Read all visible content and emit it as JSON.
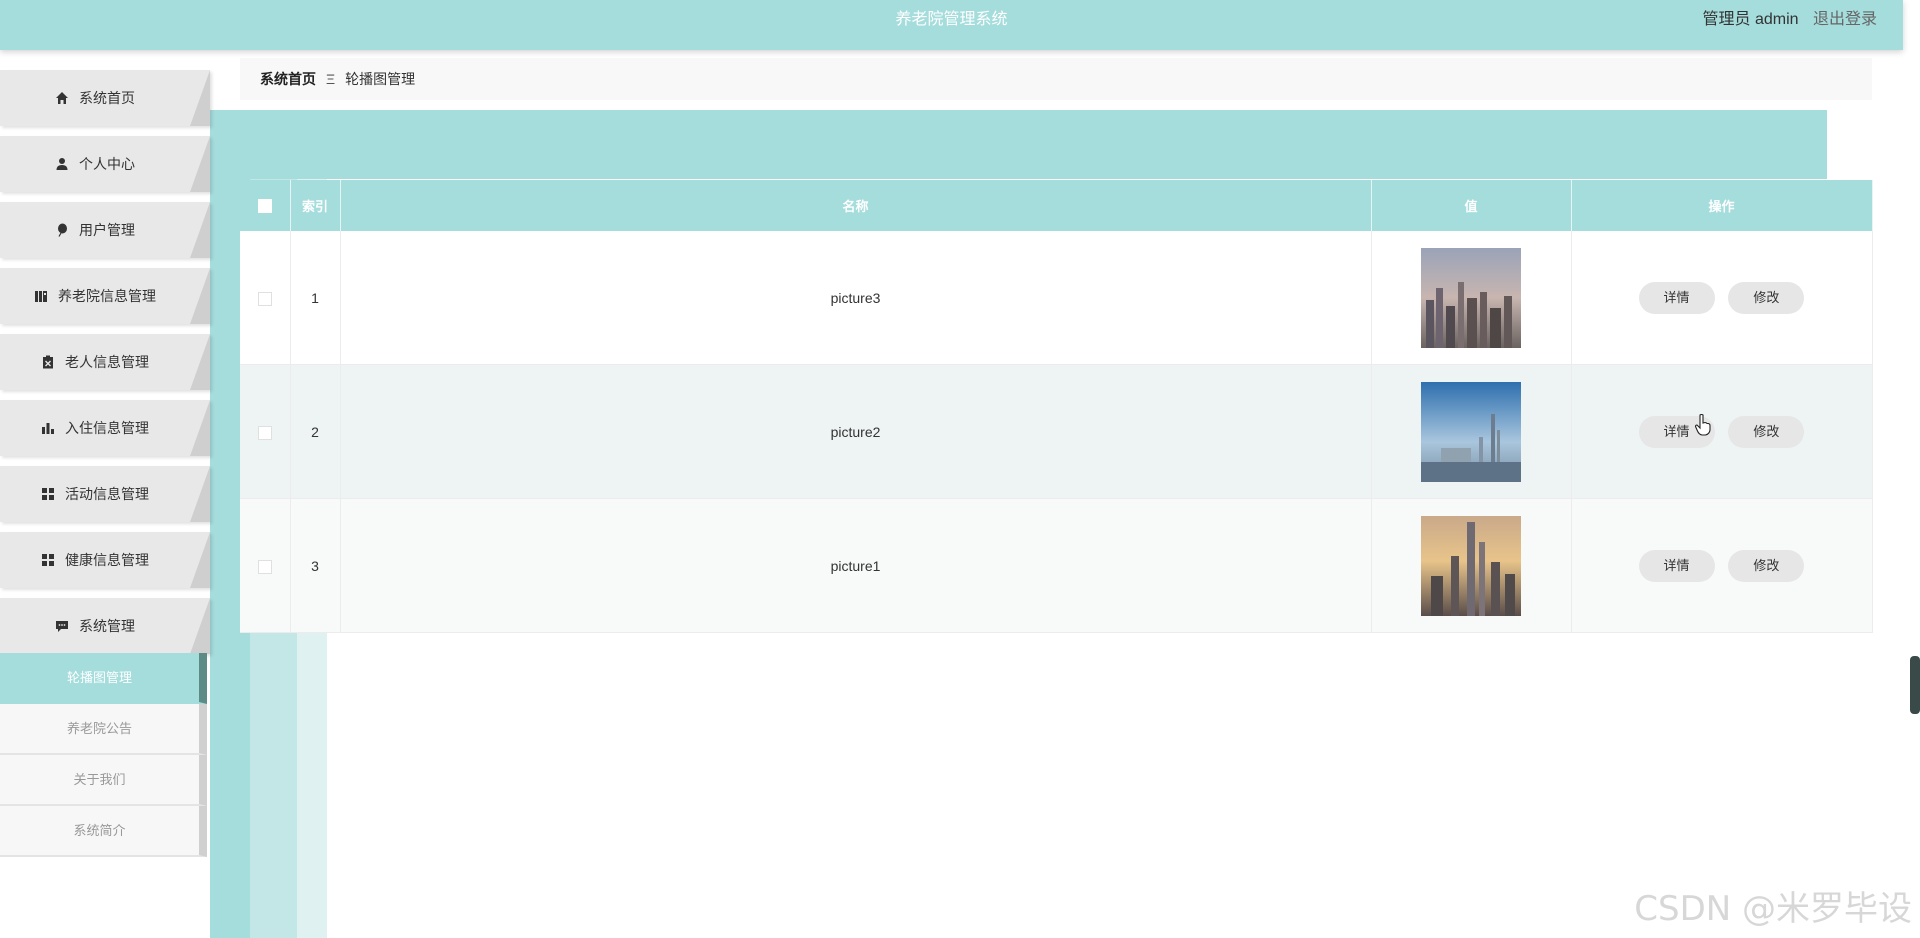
{
  "header": {
    "title": "养老院管理系统",
    "user_label": "管理员 admin",
    "logout_label": "退出登录"
  },
  "sidebar": {
    "items": [
      {
        "label": "系统首页",
        "icon": "home-icon"
      },
      {
        "label": "个人中心",
        "icon": "user-icon"
      },
      {
        "label": "用户管理",
        "icon": "balloon-icon"
      },
      {
        "label": "养老院信息管理",
        "icon": "book-icon"
      },
      {
        "label": "老人信息管理",
        "icon": "clipboard-icon"
      },
      {
        "label": "入住信息管理",
        "icon": "bar-chart-icon"
      },
      {
        "label": "活动信息管理",
        "icon": "grid-icon"
      },
      {
        "label": "健康信息管理",
        "icon": "grid-icon"
      },
      {
        "label": "系统管理",
        "icon": "chat-icon"
      }
    ],
    "submenu": [
      {
        "label": "轮播图管理",
        "active": true
      },
      {
        "label": "养老院公告",
        "active": false
      },
      {
        "label": "关于我们",
        "active": false
      },
      {
        "label": "系统简介",
        "active": false
      }
    ]
  },
  "breadcrumb": {
    "home": "系统首页",
    "separator": "Ξ",
    "current": "轮播图管理"
  },
  "table": {
    "columns": [
      "索引",
      "名称",
      "值",
      "操作"
    ],
    "rows": [
      {
        "index": "1",
        "name": "picture3",
        "image": "city-skyline-dusk"
      },
      {
        "index": "2",
        "name": "picture2",
        "image": "city-skyline-waterfront"
      },
      {
        "index": "3",
        "name": "picture1",
        "image": "city-skyline-sunset"
      }
    ],
    "detail_label": "详情",
    "edit_label": "修改"
  },
  "watermark": "CSDN @米罗毕设",
  "colors": {
    "accent": "#a5dcdc",
    "sidebar_bg": "#e8e8e8",
    "active_border": "#5d8c86"
  }
}
